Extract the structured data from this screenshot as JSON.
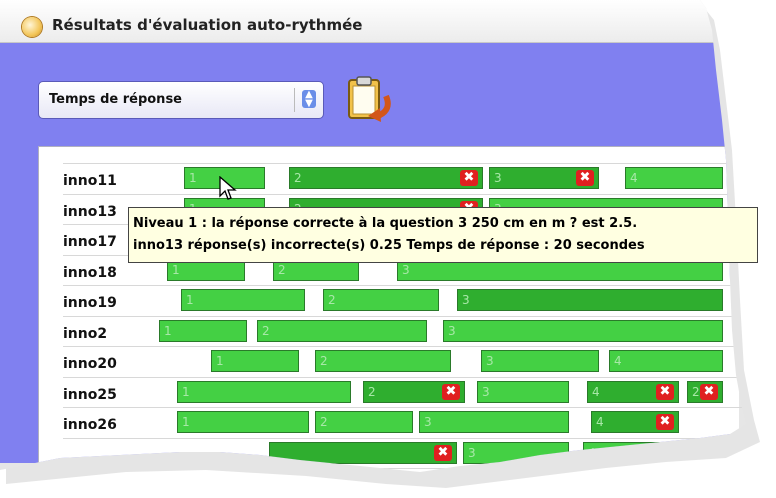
{
  "window": {
    "title": "Résultats d'évaluation auto-rythmée",
    "app_icon": "app-icon"
  },
  "toolbar": {
    "select_value": "Temps de réponse",
    "select_icon": "updown-arrow-icon",
    "export_icon": "clipboard-export-icon"
  },
  "colors": {
    "panel": "#8080f0",
    "bar_light": "#44d044",
    "bar_dark": "#2fae2f",
    "wrong": "#e02020",
    "tooltip": "#ffffe1"
  },
  "rows": [
    {
      "label": "inno11",
      "segments": [
        {
          "n": "1",
          "shade": "light",
          "wrong": false
        },
        {
          "n": "2",
          "shade": "dark",
          "wrong": true
        },
        {
          "n": "3",
          "shade": "dark",
          "wrong": true
        },
        {
          "n": "4",
          "shade": "light",
          "wrong": false
        }
      ]
    },
    {
      "label": "inno13",
      "segments": [
        {
          "n": "1",
          "shade": "light",
          "wrong": false
        },
        {
          "n": "2",
          "shade": "dark",
          "wrong": true
        },
        {
          "n": "3",
          "shade": "light",
          "wrong": false
        }
      ]
    },
    {
      "label": "inno17",
      "segments": []
    },
    {
      "label": "inno18",
      "segments": [
        {
          "n": "1",
          "shade": "light",
          "wrong": false
        },
        {
          "n": "2",
          "shade": "light",
          "wrong": false
        },
        {
          "n": "3",
          "shade": "light",
          "wrong": false
        }
      ]
    },
    {
      "label": "inno19",
      "segments": [
        {
          "n": "1",
          "shade": "light",
          "wrong": false
        },
        {
          "n": "2",
          "shade": "light",
          "wrong": false
        },
        {
          "n": "3",
          "shade": "dark",
          "wrong": false
        }
      ]
    },
    {
      "label": "inno2",
      "segments": [
        {
          "n": "1",
          "shade": "light",
          "wrong": false
        },
        {
          "n": "2",
          "shade": "light",
          "wrong": false
        },
        {
          "n": "3",
          "shade": "light",
          "wrong": false
        }
      ]
    },
    {
      "label": "inno20",
      "segments": [
        {
          "n": "1",
          "shade": "light",
          "wrong": false
        },
        {
          "n": "2",
          "shade": "light",
          "wrong": false
        },
        {
          "n": "3",
          "shade": "light",
          "wrong": false
        },
        {
          "n": "4",
          "shade": "light",
          "wrong": false
        }
      ]
    },
    {
      "label": "inno25",
      "segments": [
        {
          "n": "1",
          "shade": "light",
          "wrong": false
        },
        {
          "n": "2",
          "shade": "dark",
          "wrong": true
        },
        {
          "n": "3",
          "shade": "light",
          "wrong": false
        },
        {
          "n": "4",
          "shade": "dark",
          "wrong": true
        },
        {
          "n": "2",
          "shade": "dark",
          "wrong": true
        }
      ]
    },
    {
      "label": "inno26",
      "segments": [
        {
          "n": "1",
          "shade": "light",
          "wrong": false
        },
        {
          "n": "2",
          "shade": "light",
          "wrong": false
        },
        {
          "n": "3",
          "shade": "light",
          "wrong": false
        },
        {
          "n": "4",
          "shade": "dark",
          "wrong": true
        }
      ]
    },
    {
      "label": "",
      "segments": [
        {
          "n": "",
          "shade": "dark",
          "wrong": true
        },
        {
          "n": "3",
          "shade": "light",
          "wrong": false
        },
        {
          "n": "4",
          "shade": "light",
          "wrong": false
        }
      ]
    },
    {
      "label": "",
      "segments": [
        {
          "n": "",
          "shade": "dark",
          "wrong": true
        },
        {
          "n": "3",
          "shade": "light",
          "wrong": false
        }
      ]
    }
  ],
  "tooltip": {
    "line1": "Niveau 1 : la réponse correcte à la question 3   250 cm en m ?  est 2.5.",
    "line2": "inno13 réponse(s) incorrecte(s) 0.25 Temps de réponse : 20 secondes"
  },
  "cursor_icon": "mouse-pointer-icon"
}
